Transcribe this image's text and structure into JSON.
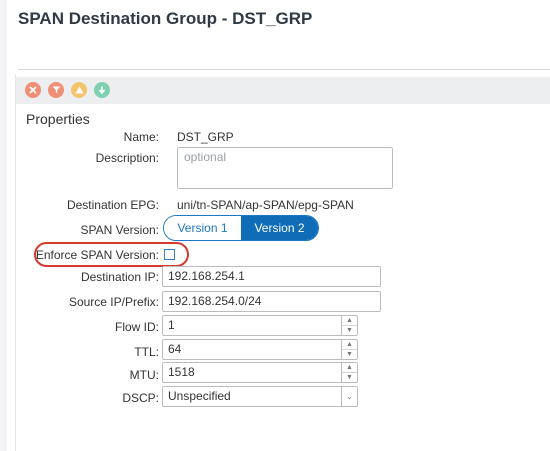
{
  "page": {
    "title": "SPAN Destination Group - DST_GRP"
  },
  "toolbar": {
    "buttons": [
      {
        "icon": "delete-icon",
        "color": "#f08e76"
      },
      {
        "icon": "filter-icon",
        "color": "#f08e76"
      },
      {
        "icon": "warning-icon",
        "color": "#f3c46b"
      },
      {
        "icon": "info-icon",
        "color": "#7fd0b0"
      }
    ]
  },
  "properties": {
    "section_title": "Properties",
    "name": {
      "label": "Name:",
      "value": "DST_GRP"
    },
    "description": {
      "label": "Description:",
      "placeholder": "optional"
    },
    "destination_epg": {
      "label": "Destination EPG:",
      "value": "uni/tn-SPAN/ap-SPAN/epg-SPAN"
    },
    "span_version": {
      "label": "SPAN Version:",
      "options": [
        "Version 1",
        "Version 2"
      ],
      "selected": "Version 2"
    },
    "enforce_span_version": {
      "label": "Enforce SPAN Version:",
      "checked": false
    },
    "destination_ip": {
      "label": "Destination IP:",
      "value": "192.168.254.1"
    },
    "source_ip_prefix": {
      "label": "Source IP/Prefix:",
      "value": "192.168.254.0/24"
    },
    "flow_id": {
      "label": "Flow ID:",
      "value": "1"
    },
    "ttl": {
      "label": "TTL:",
      "value": "64"
    },
    "mtu": {
      "label": "MTU:",
      "value": "1518"
    },
    "dscp": {
      "label": "DSCP:",
      "value": "Unspecified"
    }
  },
  "colors": {
    "accent": "#0f6cb7",
    "highlight": "#d53a2c"
  }
}
